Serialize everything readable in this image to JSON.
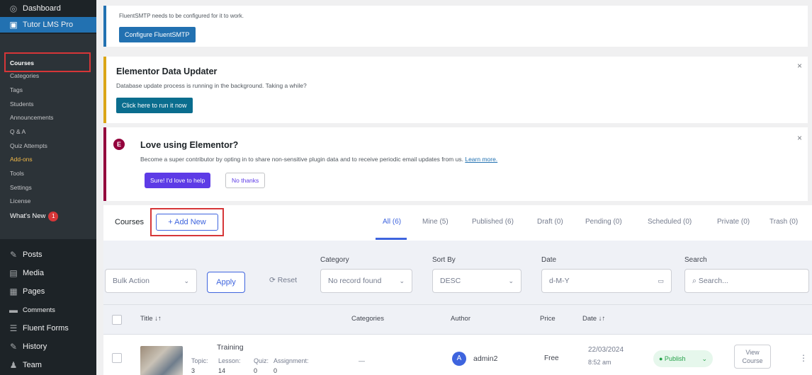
{
  "sidebar": {
    "dashboard": "Dashboard",
    "tutor": "Tutor LMS Pro",
    "submenu": [
      "Courses",
      "Categories",
      "Tags",
      "Students",
      "Announcements",
      "Q & A",
      "Quiz Attempts",
      "Add-ons",
      "Tools",
      "Settings",
      "License"
    ],
    "whats_new": "What's New",
    "whats_new_badge": "1",
    "lower": [
      "Posts",
      "Media",
      "Pages",
      "Comments",
      "Fluent Forms",
      "History",
      "Team"
    ]
  },
  "notices": {
    "fluent": {
      "text": "FluentSMTP needs to be configured for it to work.",
      "button": "Configure FluentSMTP"
    },
    "elementor_updater": {
      "title": "Elementor Data Updater",
      "text": "Database update process is running in the background. Taking a while?",
      "button": "Click here to run it now",
      "close": "×"
    },
    "love": {
      "logo": "E",
      "title": "Love using Elementor?",
      "text": "Become a super contributor by opting in to share non-sensitive plugin data and to receive periodic email updates from us.",
      "link": "Learn more.",
      "yes": "Sure! I'd love to help",
      "no": "No thanks",
      "close": "×"
    }
  },
  "header": {
    "courses_label": "Courses",
    "add_new": "+ Add New",
    "tabs": [
      "All (6)",
      "Mine (5)",
      "Published (6)",
      "Draft (0)",
      "Pending (0)",
      "Scheduled (0)",
      "Private (0)",
      "Trash (0)"
    ]
  },
  "filters": {
    "bulk_action": "Bulk Action",
    "apply": "Apply",
    "reset": "⟳ Reset",
    "category_label": "Category",
    "category_value": "No record found",
    "sort_label": "Sort By",
    "sort_value": "DESC",
    "date_label": "Date",
    "date_placeholder": "d-M-Y",
    "search_label": "Search",
    "search_placeholder": "Search..."
  },
  "table": {
    "headers": [
      "Title ↓↑",
      "Categories",
      "Author",
      "Price",
      "Date ↓↑"
    ],
    "row": {
      "title": "Training",
      "topic_label": "Topic:",
      "topic": "3",
      "lesson_label": "Lesson:",
      "lesson": "14",
      "quiz_label": "Quiz:",
      "quiz": "0",
      "assignment_label": "Assignment:",
      "assignment": "0",
      "categories": "—",
      "author_initial": "A",
      "author": "admin2",
      "price": "Free",
      "date": "22/03/2024",
      "time": "8:52 am",
      "status": "● Publish",
      "view": "View Course",
      "more": "⋮"
    }
  }
}
